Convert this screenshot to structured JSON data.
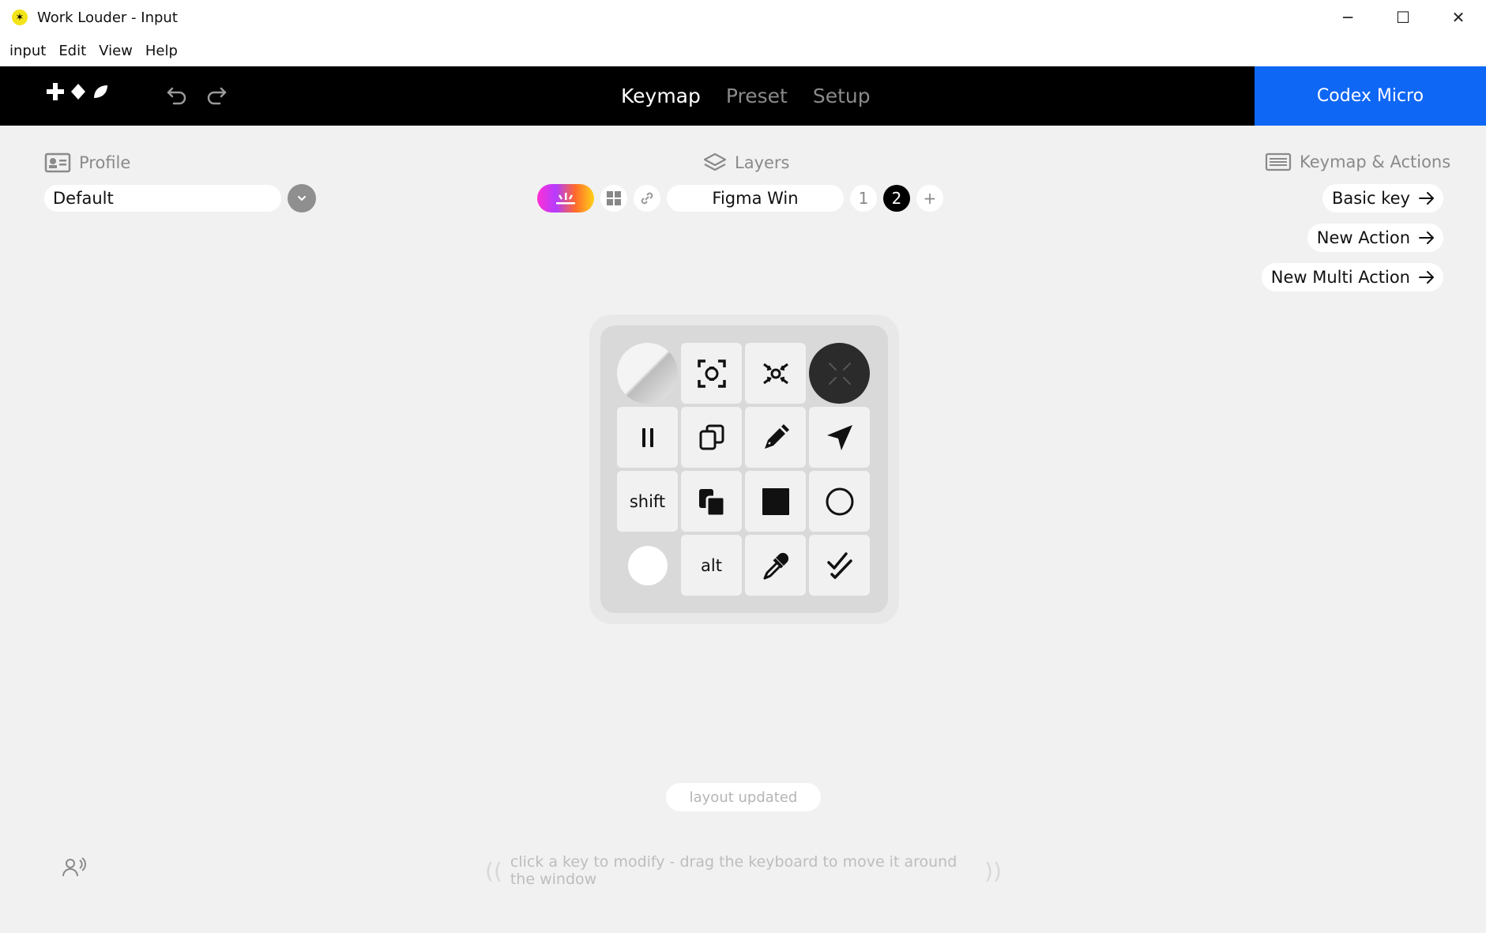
{
  "window": {
    "title": "Work Louder - Input",
    "minimize": "─",
    "maximize": "☐",
    "close": "✕"
  },
  "menu": [
    "input",
    "Edit",
    "View",
    "Help"
  ],
  "nav": {
    "tabs": [
      "Keymap",
      "Preset",
      "Setup"
    ],
    "active_tab": "Keymap",
    "device": "Codex Micro",
    "device_color": "#0f67f5"
  },
  "profile": {
    "label": "Profile",
    "selected": "Default"
  },
  "layers": {
    "label": "Layers",
    "name": "Figma Win",
    "numbers": [
      "1",
      "2"
    ],
    "active": "2",
    "add": "+"
  },
  "actions": {
    "label": "Keymap & Actions",
    "buttons": [
      "Basic key",
      "New Action",
      "New Multi Action"
    ]
  },
  "keys": {
    "r3c1": "shift",
    "r4c2": "alt"
  },
  "status": {
    "toast": "layout updated",
    "hint": "click a key to modify - drag the keyboard to move it around the window"
  }
}
